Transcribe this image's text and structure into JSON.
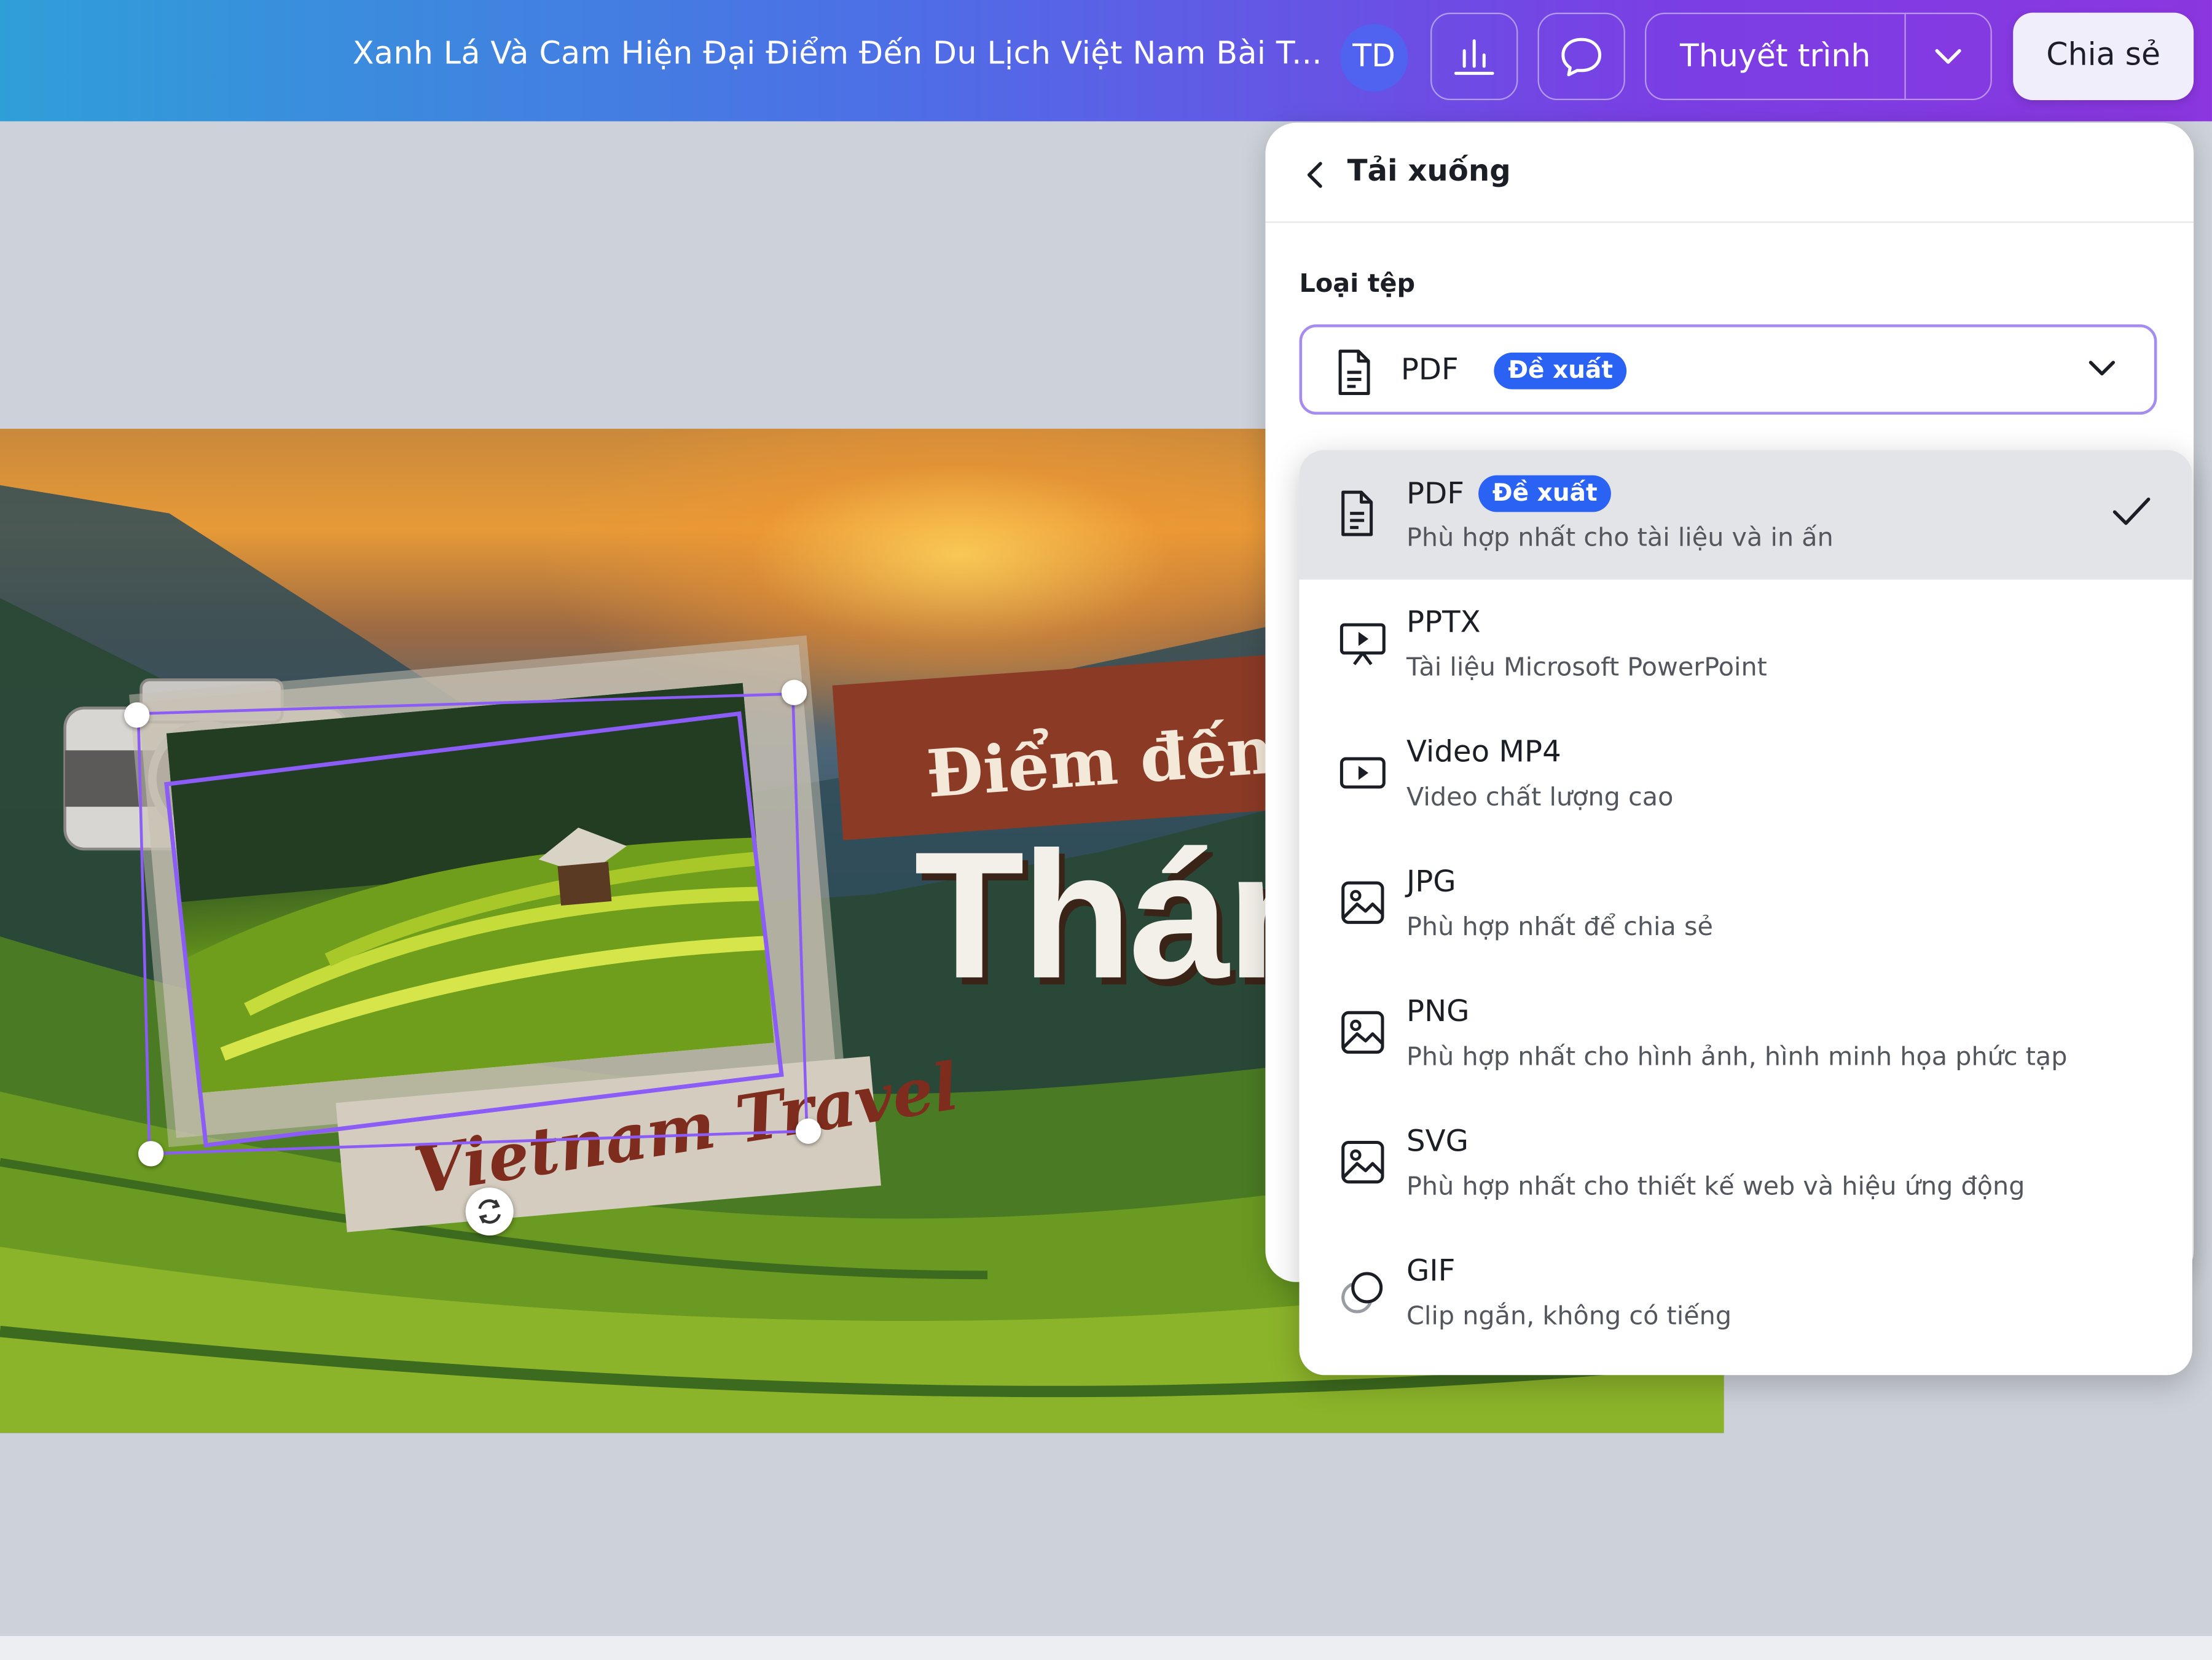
{
  "topbar": {
    "doc_title": "Xanh Lá Và Cam Hiện Đại Điểm Đến Du Lịch Việt Nam  Bài T...",
    "avatar_initials": "TD",
    "present_label": "Thuyết trình",
    "share_label": "Chia sẻ",
    "icons": [
      "bar-chart-icon",
      "comment-icon",
      "chevron-down-icon"
    ]
  },
  "slide": {
    "title_line1": "Điểm đến đẹ",
    "title_line2": "Thán",
    "label_text": "Vietnam Travel"
  },
  "download_panel": {
    "title": "Tải xuống",
    "file_type_label": "Loại tệp",
    "selected_value": "PDF",
    "selected_badge": "Đề xuất",
    "options": [
      {
        "name": "PDF",
        "badge": "Đề xuất",
        "desc": "Phù hợp nhất cho tài liệu và in ấn",
        "icon": "document-icon",
        "selected": true
      },
      {
        "name": "PPTX",
        "desc": "Tài liệu Microsoft PowerPoint",
        "icon": "presentation-icon"
      },
      {
        "name": "Video MP4",
        "desc": "Video chất lượng cao",
        "icon": "video-icon"
      },
      {
        "name": "JPG",
        "desc": "Phù hợp nhất để chia sẻ",
        "icon": "image-icon"
      },
      {
        "name": "PNG",
        "desc": "Phù hợp nhất cho hình ảnh, hình minh họa phức tạp",
        "icon": "image-icon"
      },
      {
        "name": "SVG",
        "desc": "Phù hợp nhất cho thiết kế web và hiệu ứng động",
        "icon": "image-icon"
      },
      {
        "name": "GIF",
        "desc": "Clip ngắn, không có tiếng",
        "icon": "gif-icon"
      }
    ]
  },
  "colors": {
    "accent": "#2a62f3",
    "select_border": "#a58cf0",
    "title_band": "#8a3a25"
  }
}
